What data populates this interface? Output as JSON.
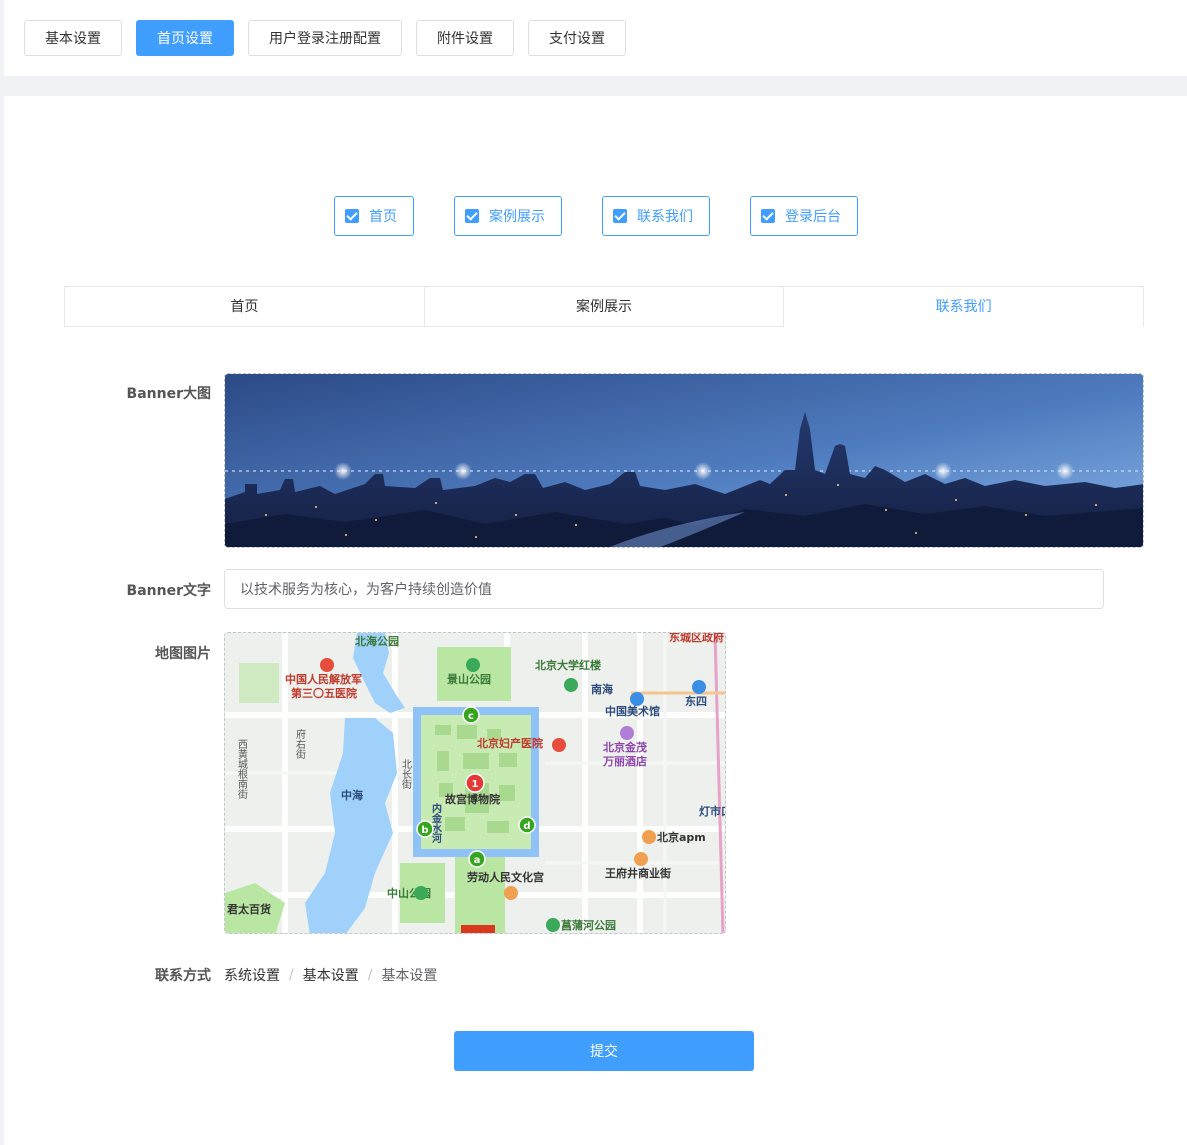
{
  "top_tabs": [
    {
      "label": "基本设置",
      "active": false
    },
    {
      "label": "首页设置",
      "active": true
    },
    {
      "label": "用户登录注册配置",
      "active": false
    },
    {
      "label": "附件设置",
      "active": false
    },
    {
      "label": "支付设置",
      "active": false
    }
  ],
  "checkboxes": [
    {
      "label": "首页",
      "checked": true
    },
    {
      "label": "案例展示",
      "checked": true
    },
    {
      "label": "联系我们",
      "checked": true
    },
    {
      "label": "登录后台",
      "checked": true
    }
  ],
  "segments": [
    {
      "label": "首页",
      "active": false
    },
    {
      "label": "案例展示",
      "active": false
    },
    {
      "label": "联系我们",
      "active": true
    }
  ],
  "form": {
    "banner_label": "Banner大图",
    "banner_text_label": "Banner文字",
    "banner_text_value": "以技术服务为核心，为客户持续创造价值",
    "map_label": "地图图片",
    "contact_label": "联系方式",
    "contact_breadcrumb": [
      "系统设置",
      "基本设置",
      "基本设置"
    ],
    "submit_label": "提交"
  },
  "map": {
    "places": {
      "beihai": "北海公园",
      "jingshan": "景山公园",
      "hospital305": "中国人民解放军",
      "hospital305b": "第三〇五医院",
      "pku_red": "北京大学红楼",
      "nanhai": "南海",
      "art_museum": "中国美术馆",
      "dongsi": "东四",
      "jinmao": "北京金茂",
      "jinmao2": "万丽酒店",
      "maternity": "北京妇产医院",
      "palace": "故宫博物院",
      "zhonghai": "中海",
      "neijin": "内金水河",
      "apm": "北京apm",
      "wangfujing": "王府井商业街",
      "laodong": "劳动人民文化宫",
      "zhongshan": "中山公园",
      "junjun": "君太百货",
      "changpu": "菖蒲河公园",
      "dengshi": "灯市口",
      "dongcheng": "东城区政府",
      "xihuang": "西黄城根南街",
      "fuyou": "府右街",
      "beichang": "北长街"
    },
    "markers": [
      "1",
      "a",
      "b",
      "c",
      "d"
    ]
  },
  "colors": {
    "primary": "#409eff",
    "border": "#dcdfe6",
    "map_green": "#b9e6a3",
    "map_water": "#9fd1fb"
  }
}
